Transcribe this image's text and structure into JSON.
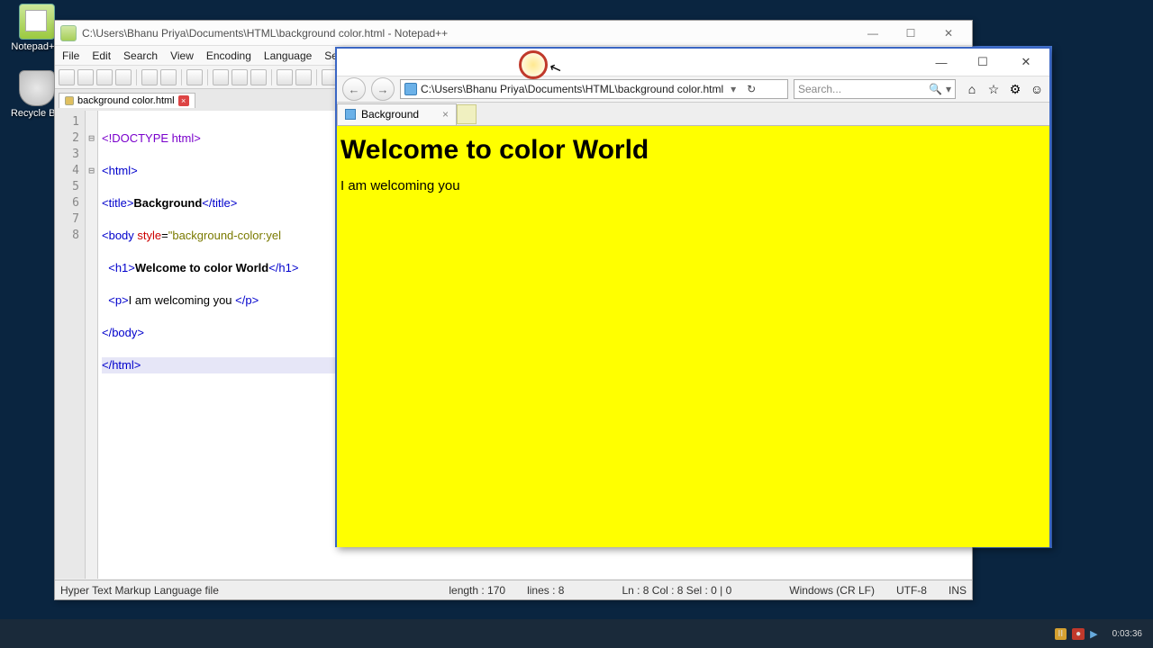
{
  "desktop": {
    "icons": [
      {
        "name": "notepadpp",
        "label": "Notepad+..."
      },
      {
        "name": "recyclebin",
        "label": "Recycle Bin"
      }
    ]
  },
  "npp": {
    "title": "C:\\Users\\Bhanu Priya\\Documents\\HTML\\background color.html - Notepad++",
    "menu": [
      "File",
      "Edit",
      "Search",
      "View",
      "Encoding",
      "Language",
      "Settings"
    ],
    "tab_label": "background color.html",
    "code": {
      "l1": "<!DOCTYPE html>",
      "l2": "<html>",
      "l3_a": "<title>",
      "l3_b": "Background",
      "l3_c": "</title>",
      "l4_a": "<body ",
      "l4_attr": "style",
      "l4_eq": "=",
      "l4_str": "\"background-color:yel",
      "l5_a": "<h1>",
      "l5_b": "Welcome to color World",
      "l5_c": "</h1>",
      "l6_a": "<p>",
      "l6_b": "I am welcoming you ",
      "l6_c": "</p>",
      "l7": "</body>",
      "l8": "</html>"
    },
    "status": {
      "type": "Hyper Text Markup Language file",
      "length": "length : 170",
      "lines": "lines : 8",
      "pos": "Ln : 8   Col : 8   Sel : 0 | 0",
      "eol": "Windows (CR LF)",
      "enc": "UTF-8",
      "ins": "INS"
    }
  },
  "ie": {
    "address": "C:\\Users\\Bhanu Priya\\Documents\\HTML\\background color.html",
    "search_placeholder": "Search...",
    "tab_label": "Background",
    "page": {
      "heading": "Welcome to color World",
      "para": "I am welcoming you"
    }
  },
  "taskbar": {
    "time": "0:03:36",
    "date": ""
  }
}
